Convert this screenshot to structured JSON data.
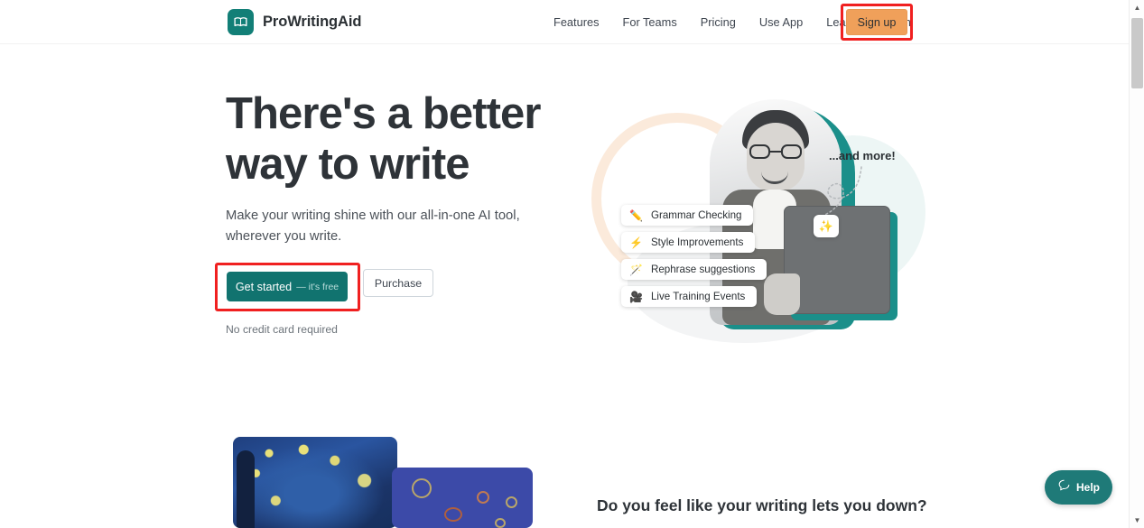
{
  "header": {
    "brand": {
      "name": "ProWritingAid",
      "icon": "book-logo-icon"
    },
    "nav": [
      {
        "label": "Features"
      },
      {
        "label": "For Teams"
      },
      {
        "label": "Pricing"
      },
      {
        "label": "Use App"
      },
      {
        "label": "Learn"
      },
      {
        "label": "Log in"
      }
    ],
    "signup_label": "Sign up"
  },
  "hero": {
    "title_line1": "There's a better",
    "title_line2": "way to write",
    "subtitle": "Make your writing shine with our all-in-one AI tool, wherever you write.",
    "cta_primary": "Get started",
    "cta_primary_suffix": "— it's free",
    "cta_secondary": "Purchase",
    "note": "No credit card required",
    "and_more": "...and more!",
    "features": [
      {
        "label": "Grammar Checking",
        "icon": "✏️"
      },
      {
        "label": "Style Improvements",
        "icon": "⚡"
      },
      {
        "label": "Rephrase suggestions",
        "icon": "🪄"
      },
      {
        "label": "Live Training Events",
        "icon": "🎥"
      }
    ],
    "sparkle_icon": "✨"
  },
  "section": {
    "heading": "Do you feel like your writing lets you down?"
  },
  "help": {
    "label": "Help",
    "icon": "chat-bubble-icon"
  },
  "scrollbar": {
    "up": "▲",
    "down": "▼"
  },
  "colors": {
    "brand_teal": "#127f77",
    "cta_teal": "#11736f",
    "signup_orange": "#f0a05a",
    "annotation_red": "#f02020",
    "text_dark": "#2e3338"
  }
}
